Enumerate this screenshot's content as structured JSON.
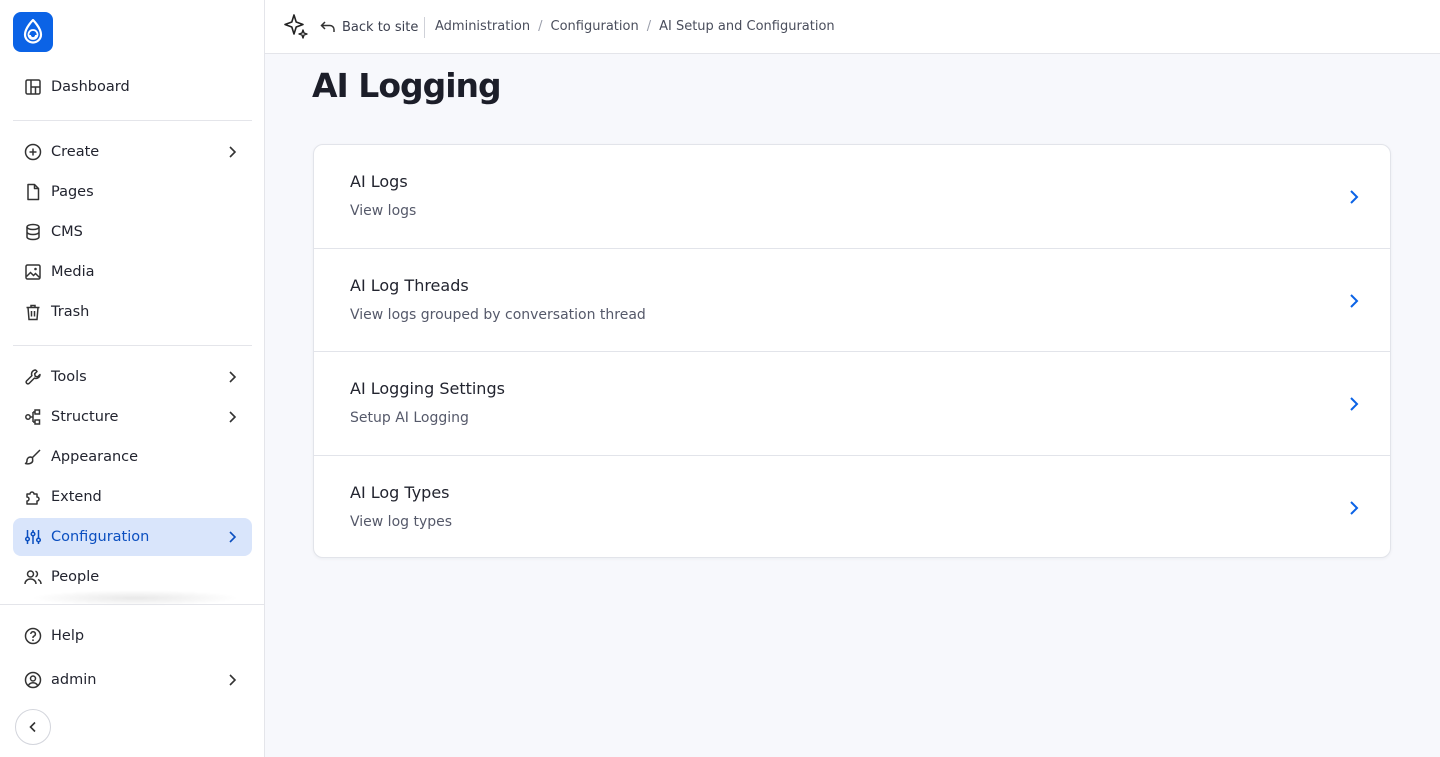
{
  "sidebar": {
    "top_items": [
      {
        "label": "Dashboard",
        "icon": "dashboard-icon"
      }
    ],
    "content_items": [
      {
        "label": "Create",
        "icon": "plus-circle-icon",
        "has_submenu": true
      },
      {
        "label": "Pages",
        "icon": "file-icon"
      },
      {
        "label": "CMS",
        "icon": "database-icon"
      },
      {
        "label": "Media",
        "icon": "image-icon"
      },
      {
        "label": "Trash",
        "icon": "trash-icon"
      }
    ],
    "admin_items": [
      {
        "label": "Tools",
        "icon": "wrench-icon",
        "has_submenu": true
      },
      {
        "label": "Structure",
        "icon": "structure-icon",
        "has_submenu": true
      },
      {
        "label": "Appearance",
        "icon": "brush-icon"
      },
      {
        "label": "Extend",
        "icon": "puzzle-icon"
      },
      {
        "label": "Configuration",
        "icon": "sliders-icon",
        "has_submenu": true,
        "active": true
      },
      {
        "label": "People",
        "icon": "people-icon"
      }
    ],
    "footer_items": [
      {
        "label": "Help",
        "icon": "help-icon"
      },
      {
        "label": "admin",
        "icon": "user-circle-icon",
        "has_submenu": true
      }
    ]
  },
  "topbar": {
    "back_label": "Back to site",
    "breadcrumbs": [
      "Administration",
      "Configuration",
      "AI Setup and Configuration"
    ]
  },
  "main": {
    "title": "AI Logging",
    "items": [
      {
        "title": "AI Logs",
        "description": "View logs"
      },
      {
        "title": "AI Log Threads",
        "description": "View logs grouped by conversation thread"
      },
      {
        "title": "AI Logging Settings",
        "description": "Setup AI Logging"
      },
      {
        "title": "AI Log Types",
        "description": "View log types"
      }
    ]
  },
  "colors": {
    "accent": "#0b63e6",
    "active_bg": "#d9e5fb",
    "page_bg": "#f7f8fc"
  }
}
